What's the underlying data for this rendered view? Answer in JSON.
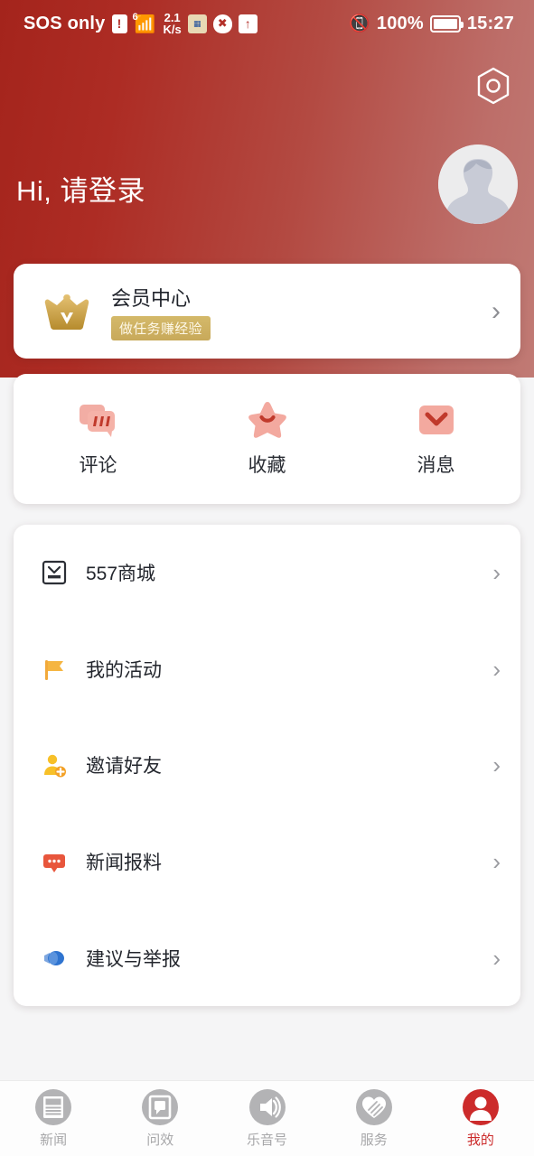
{
  "status_bar": {
    "carrier": "SOS only",
    "alert_badge": "!",
    "wifi_gen": "6",
    "speed_value": "2.1",
    "speed_unit": "K/s",
    "icons": [
      "card-icon",
      "shield-block-icon",
      "upload-arrow-icon"
    ],
    "vibrate_icon": "vibrate-icon",
    "battery_percent": "100%",
    "time": "15:27"
  },
  "header": {
    "settings_icon": "settings-hexagon-icon",
    "greeting": "Hi, 请登录",
    "avatar_icon": "default-avatar-icon",
    "gradient_from": "#a4241c",
    "gradient_to": "#c07a74"
  },
  "member_card": {
    "icon": "crown-icon",
    "title": "会员中心",
    "badge": "做任务赚经验",
    "chevron": "chevron-right-icon",
    "badge_color": "#c8a95a"
  },
  "quick_actions": [
    {
      "icon": "comment-bubbles-icon",
      "label": "评论"
    },
    {
      "icon": "star-favorite-icon",
      "label": "收藏"
    },
    {
      "icon": "message-envelope-icon",
      "label": "消息"
    }
  ],
  "menu": [
    {
      "icon": "mall-bag-icon",
      "label": "557商城",
      "chevron": "chevron-right-icon"
    },
    {
      "icon": "flag-icon",
      "label": "我的活动",
      "chevron": "chevron-right-icon"
    },
    {
      "icon": "invite-friend-icon",
      "label": "邀请好友",
      "chevron": "chevron-right-icon"
    },
    {
      "icon": "news-report-icon",
      "label": "新闻报料",
      "chevron": "chevron-right-icon"
    },
    {
      "icon": "suggestion-report-icon",
      "label": "建议与举报",
      "chevron": "chevron-right-icon"
    }
  ],
  "bottom_nav": {
    "active_color": "#cc2b2b",
    "inactive_color": "#a7a7a9",
    "items": [
      {
        "icon": "news-icon",
        "label": "新闻",
        "active": false
      },
      {
        "icon": "inquiry-icon",
        "label": "问效",
        "active": false
      },
      {
        "icon": "audio-number-icon",
        "label": "乐音号",
        "active": false
      },
      {
        "icon": "service-heart-icon",
        "label": "服务",
        "active": false
      },
      {
        "icon": "profile-icon",
        "label": "我的",
        "active": true
      }
    ]
  }
}
